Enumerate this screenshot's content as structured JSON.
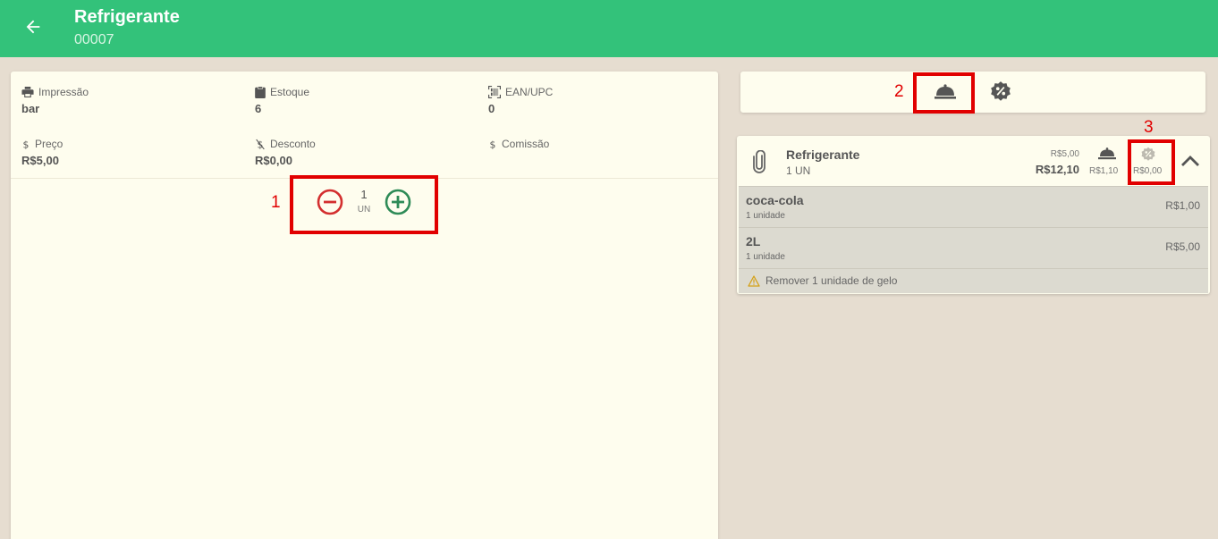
{
  "header": {
    "title": "Refrigerante",
    "code": "00007",
    "color": "#33c27a"
  },
  "product_info": {
    "impressao": {
      "label": "Impressão",
      "value": "bar",
      "icon": "printer-icon"
    },
    "estoque": {
      "label": "Estoque",
      "value": "6",
      "icon": "clipboard-icon"
    },
    "ean": {
      "label": "EAN/UPC",
      "value": "0",
      "icon": "barcode-scan-icon"
    },
    "preco": {
      "label": "Preço",
      "value": "R$5,00",
      "icon": "dollar-icon"
    },
    "desconto": {
      "label": "Desconto",
      "value": "R$0,00",
      "icon": "dollar-off-icon"
    },
    "comissao": {
      "label": "Comissão",
      "value": "",
      "icon": "dollar-icon"
    }
  },
  "quantity": {
    "value": "1",
    "unit": "UN",
    "minus_color": "#d32f2f",
    "plus_color": "#2e8b57"
  },
  "annotations": {
    "one": "1",
    "two": "2",
    "three": "3",
    "color": "#e10000"
  },
  "right_toolbar": {
    "buttons": [
      "service-bell-icon",
      "discount-badge-icon"
    ]
  },
  "order_item": {
    "name": "Refrigerante",
    "qty": "1 UN",
    "unit_price": "R$5,00",
    "total": "R$12,10",
    "service_value": "R$1,10",
    "discount_value": "R$0,00",
    "addons": [
      {
        "name": "coca-cola",
        "qty": "1 unidade",
        "price": "R$1,00"
      },
      {
        "name": "2L",
        "qty": "1 unidade",
        "price": "R$5,00"
      }
    ],
    "note": "Remover 1 unidade de gelo"
  }
}
